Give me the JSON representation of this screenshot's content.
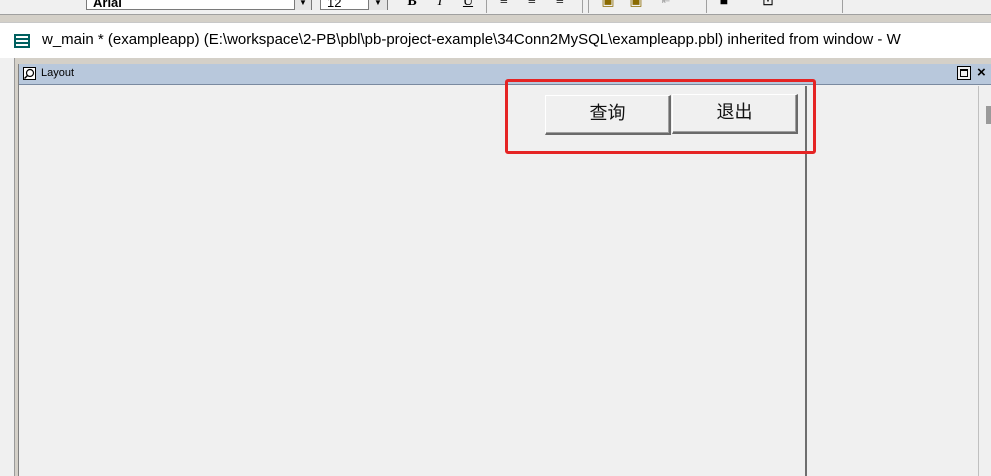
{
  "toolbar": {
    "font_name": "Arial",
    "font_size": "12",
    "bold_glyph": "B",
    "italic_glyph": "I",
    "underline_glyph": "U"
  },
  "window": {
    "title": "w_main * (exampleapp) (E:\\workspace\\2-PB\\pbl\\pb-project-example\\34Conn2MySQL\\exampleapp.pbl) inherited from window - W"
  },
  "layout_panel": {
    "title": "Layout",
    "close_glyph": "×"
  },
  "buttons": {
    "query_label": "查询",
    "exit_label": "退出"
  },
  "colors": {
    "highlight": "#e52424",
    "panel_header": "#b8c8dc"
  }
}
